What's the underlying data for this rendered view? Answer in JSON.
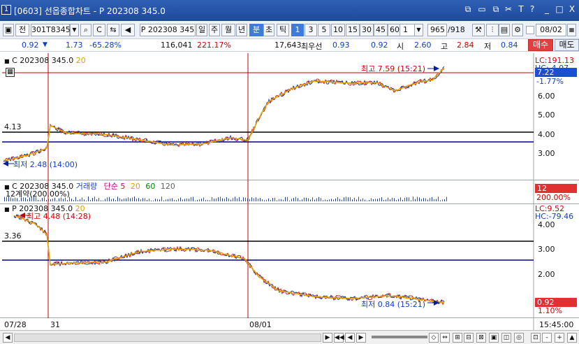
{
  "window": {
    "num": "1",
    "title": "[0603] 선옵종합차트 - P 202308 345.0"
  },
  "title_icons": [
    "restore-icon",
    "grid-icon",
    "copy-icon",
    "cut-icon",
    "text-icon",
    "help-icon"
  ],
  "title_ctrl": [
    "_",
    "□",
    "X"
  ],
  "toolbar": {
    "jeon": "전",
    "code": "301T8345",
    "dropdown": "▼",
    "c_label": "C",
    "symbol": "P 202308 345",
    "periods": [
      "일",
      "주",
      "월",
      "년",
      "분",
      "초",
      "틱"
    ],
    "active_period": "분",
    "intervals": [
      "1",
      "3",
      "5",
      "10",
      "15",
      "30",
      "45",
      "60"
    ],
    "active_interval": "1",
    "interval_value": "1",
    "count": "965",
    "count_total": "/918",
    "date": "08/02"
  },
  "infobar": {
    "val1": "0.92",
    "val1_arrow": "▼",
    "chg": "1.73",
    "chg_pct": "-65.28%",
    "volume": "116,041",
    "vol_pct": "221.17%",
    "qty": "17,643",
    "best_label": "최우선",
    "best1": "0.93",
    "best2": "0.92",
    "open_label": "시",
    "open": "2.60",
    "high_label": "고",
    "high": "2.84",
    "low_label": "저",
    "low": "0.84",
    "buy": "매수",
    "sell": "매도"
  },
  "top_chart": {
    "legend": "C 202308 345.0",
    "ma": "20",
    "max_text": "최고 7.59 (15:21)",
    "min_text": "최저 2.48 (14:00)",
    "level_label": "4.13",
    "right": {
      "lc": "LC:191.13",
      "hc": "HC:-4.07",
      "price": "7.22",
      "pct": "-1.77%"
    },
    "yaxis": [
      "6.00",
      "5.00",
      "4.00",
      "3.00"
    ],
    "yvals": [
      6.0,
      5.0,
      4.0,
      3.0
    ],
    "ylim": [
      2.0,
      7.9
    ]
  },
  "vol_chart": {
    "legend_c": "C 202308 345.0",
    "legend_vol": "거래량",
    "legend_ma": "단순",
    "ma_vals": [
      "5",
      "20",
      "60",
      "120"
    ],
    "sub": "12계약(200.00%)",
    "right_val": "12",
    "right_pct": "200.00%",
    "ma_colors": [
      "#c00080",
      "#e0a000",
      "#008000",
      "#606060"
    ]
  },
  "bot_chart": {
    "legend": "P 202308 345.0",
    "ma": "20",
    "max_text": "최고 4.48 (14:28)",
    "min_text": "최저 0.84 (15:21)",
    "level_label": "3.36",
    "right": {
      "lc": "LC:9.52",
      "hc": "HC:-79.46",
      "price": "0.92",
      "pct": "1.10%"
    },
    "yaxis": [
      "4.00",
      "3.00",
      "2.00"
    ],
    "yvals": [
      4.0,
      3.0,
      2.0
    ],
    "ylim": [
      0.5,
      4.9
    ]
  },
  "xaxis": {
    "labels": [
      "07/28",
      "31",
      "08/01"
    ],
    "time": "15:45:00"
  }
}
